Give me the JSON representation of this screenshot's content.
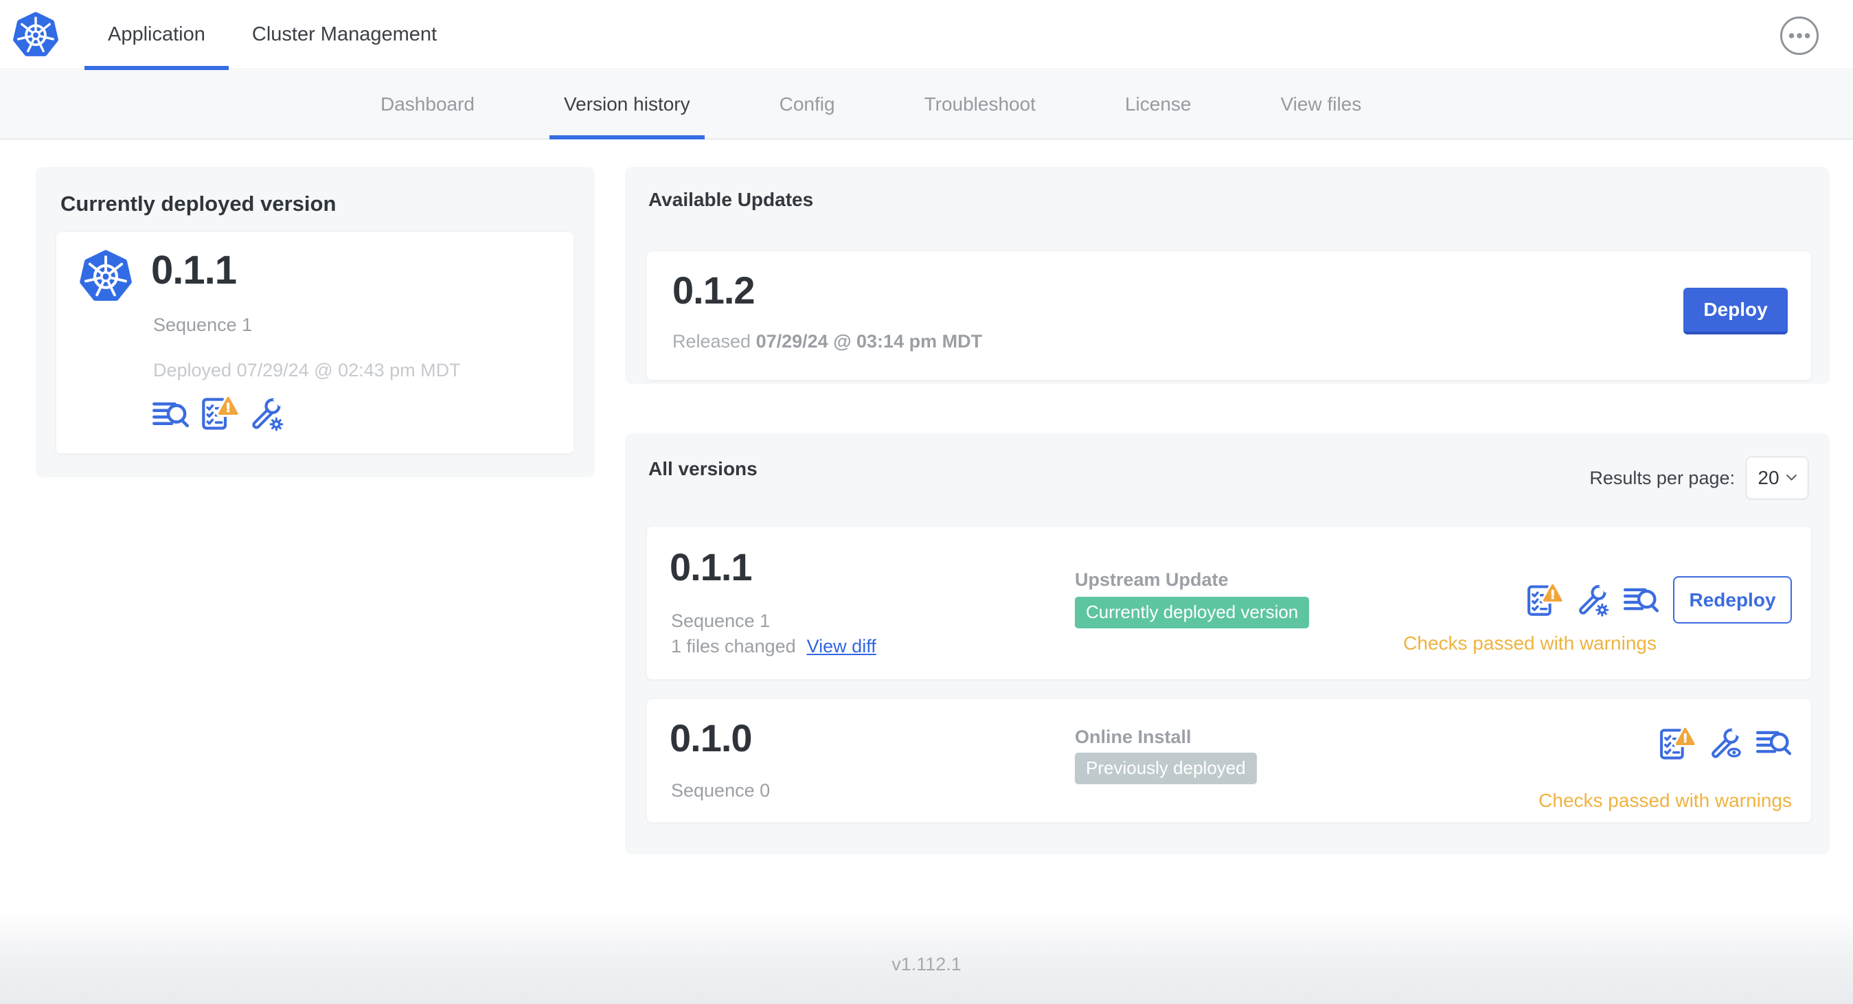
{
  "header": {
    "logo_icon": "kubernetes-logo",
    "tabs": [
      {
        "label": "Application",
        "active": true
      },
      {
        "label": "Cluster Management",
        "active": false
      }
    ],
    "menu_icon": "ellipsis-menu"
  },
  "subnav": {
    "items": [
      "Dashboard",
      "Version history",
      "Config",
      "Troubleshoot",
      "License",
      "View files"
    ],
    "active": "Version history"
  },
  "current_card": {
    "title": "Currently deployed version",
    "icon": "kubernetes-logo",
    "version": "0.1.1",
    "sequence": "Sequence 1",
    "deployed": "Deployed 07/29/24 @ 02:43 pm MDT",
    "icons": [
      "deploy-logs-icon",
      "preflight-checks-warning-icon",
      "config-wrench-gear-icon"
    ]
  },
  "available_updates": {
    "title": "Available Updates",
    "version": "0.1.2",
    "released_label": "Released",
    "released_date": "07/29/24 @ 03:14 pm MDT",
    "deploy_button": "Deploy"
  },
  "all_versions": {
    "title": "All versions",
    "results_per_page_label": "Results per page:",
    "results_per_page_value": "20",
    "rows": [
      {
        "version": "0.1.1",
        "sequence": "Sequence 1",
        "files_changed": "1 files changed",
        "view_diff_link": "View diff",
        "source": "Upstream Update",
        "badge": {
          "label": "Currently deployed version",
          "type": "green"
        },
        "icons": [
          "preflight-checks-warning-icon",
          "config-wrench-gear-icon",
          "deploy-logs-icon"
        ],
        "action_button": "Redeploy",
        "status": "Checks passed with warnings"
      },
      {
        "version": "0.1.0",
        "sequence": "Sequence 0",
        "source": "Online Install",
        "badge": {
          "label": "Previously deployed",
          "type": "gray"
        },
        "icons": [
          "preflight-checks-warning-icon",
          "config-wrench-eye-icon",
          "deploy-logs-icon"
        ],
        "status": "Checks passed with warnings"
      }
    ]
  },
  "footer": {
    "version": "v1.112.1"
  },
  "colors": {
    "accent_blue": "#3b6cdf",
    "kubernetes_blue": "#326ce5",
    "badge_green": "#5dc5a0",
    "badge_gray": "#c0cacd",
    "warning_amber": "#eeb340",
    "link_blue": "#3167e1",
    "nav_background": "#f6f8f9",
    "card_background": "#f5f7f9"
  }
}
